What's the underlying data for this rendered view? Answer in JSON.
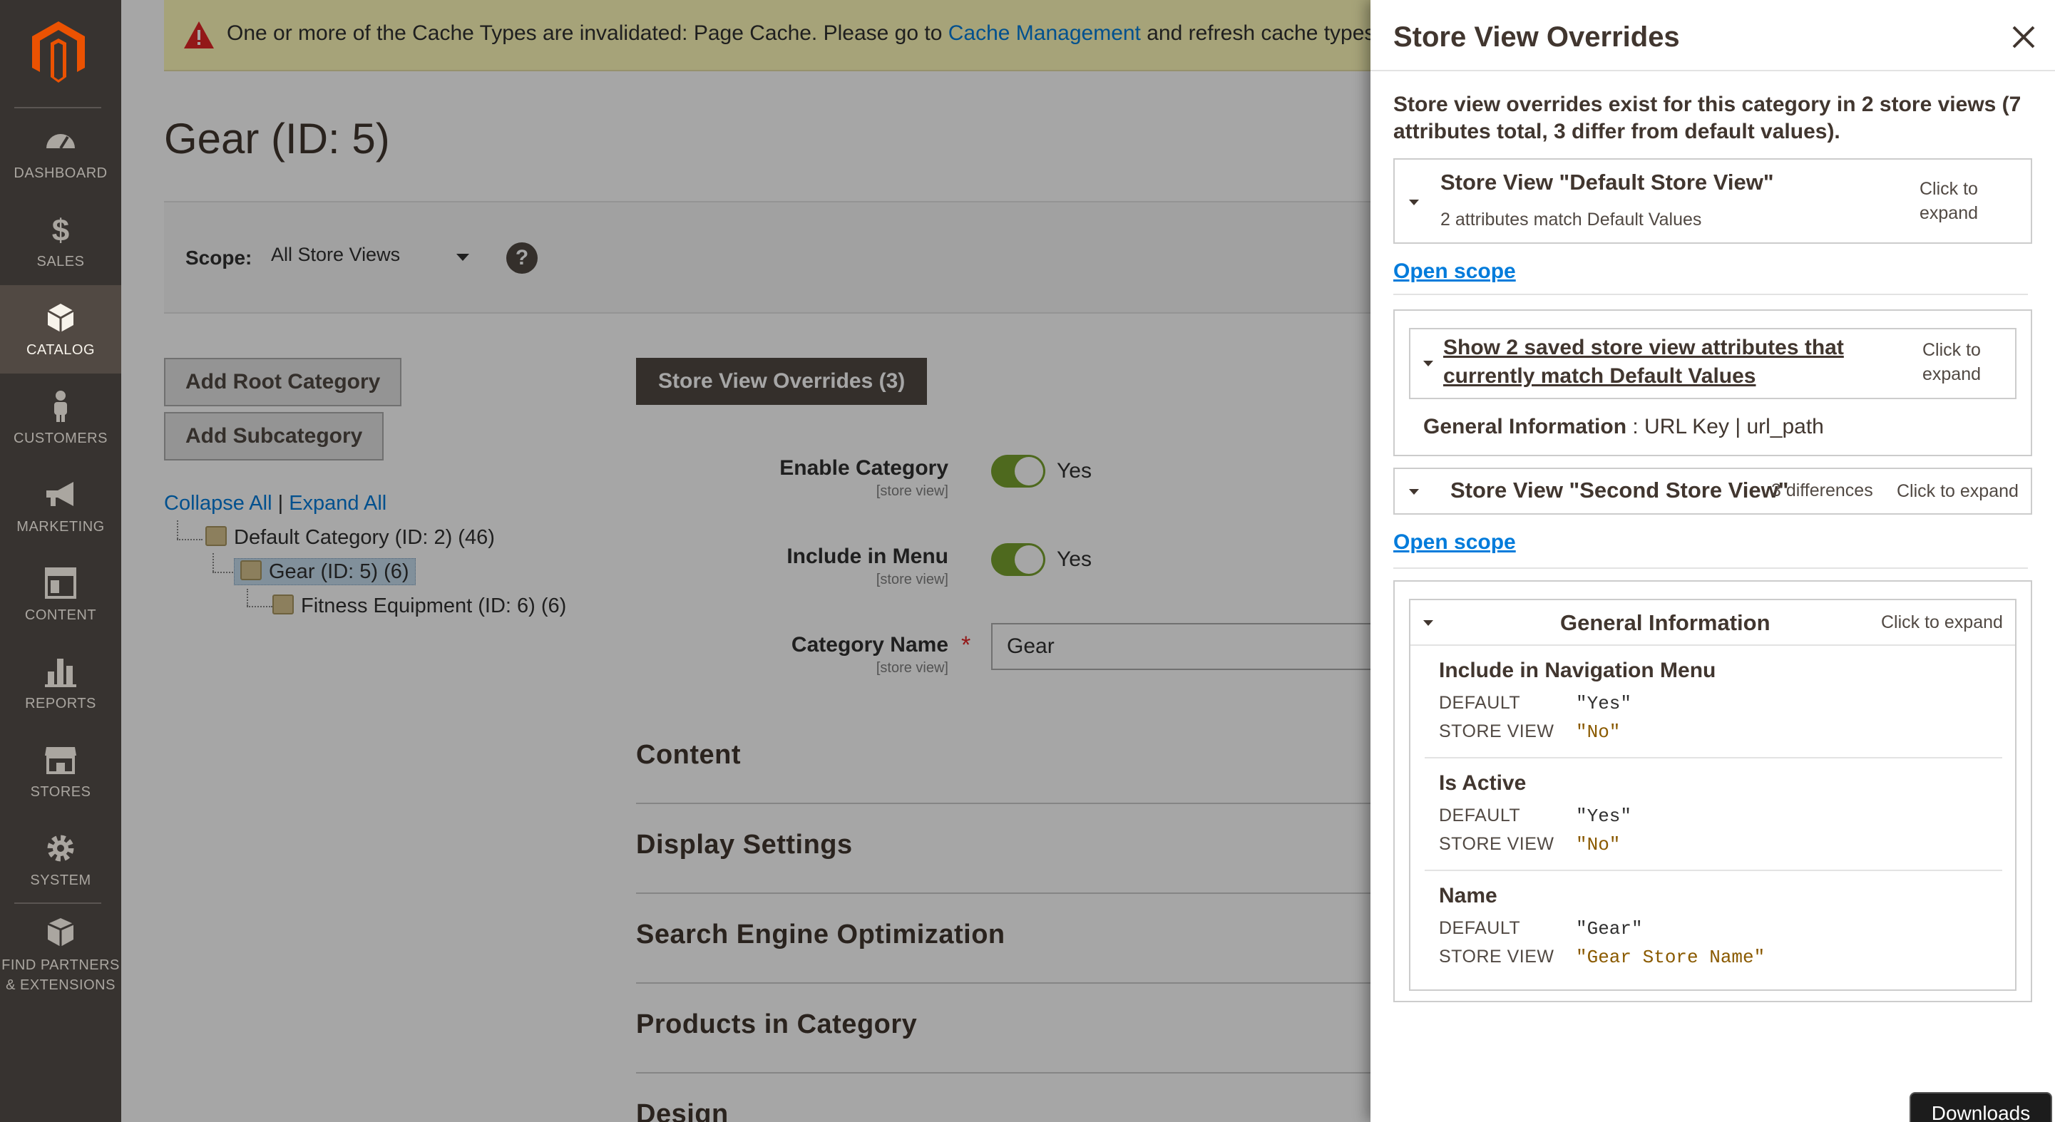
{
  "sidebar": {
    "items": [
      {
        "label": "DASHBOARD",
        "icon": "dashboard-icon"
      },
      {
        "label": "SALES",
        "icon": "dollar-icon"
      },
      {
        "label": "CATALOG",
        "icon": "cube-icon",
        "active": true
      },
      {
        "label": "CUSTOMERS",
        "icon": "person-icon"
      },
      {
        "label": "MARKETING",
        "icon": "megaphone-icon"
      },
      {
        "label": "CONTENT",
        "icon": "layout-icon"
      },
      {
        "label": "REPORTS",
        "icon": "bar-chart-icon"
      },
      {
        "label": "STORES",
        "icon": "storefront-icon"
      },
      {
        "label": "SYSTEM",
        "icon": "gear-icon"
      }
    ],
    "partners": {
      "line1": "FIND PARTNERS",
      "line2": "& EXTENSIONS",
      "icon": "package-icon"
    }
  },
  "notice": {
    "before": "One or more of the Cache Types are invalidated: Page Cache. Please go to ",
    "link": "Cache Management",
    "after": " and refresh cache types."
  },
  "page_title": "Gear (ID: 5)",
  "scope": {
    "label": "Scope:",
    "value": "All Store Views",
    "help": "?"
  },
  "buttons": {
    "add_root": "Add Root Category",
    "add_sub": "Add Subcategory",
    "overrides": "Store View Overrides (3)"
  },
  "tree": {
    "collapse": "Collapse All",
    "separator": "|",
    "expand": "Expand All",
    "nodes": [
      "Default Category (ID: 2) (46)",
      "Gear (ID: 5) (6)",
      "Fitness Equipment (ID: 6) (6)"
    ]
  },
  "fields": {
    "enable": {
      "label": "Enable Category",
      "scope": "[store view]",
      "value": "Yes"
    },
    "menu": {
      "label": "Include in Menu",
      "scope": "[store view]",
      "value": "Yes"
    },
    "name": {
      "label": "Category Name",
      "scope": "[store view]",
      "value": "Gear",
      "required": "*"
    }
  },
  "sections": [
    "Content",
    "Display Settings",
    "Search Engine Optimization",
    "Products in Category",
    "Design"
  ],
  "panel": {
    "title": "Store View Overrides",
    "summary": "Store view overrides exist for this category in 2 store views (7 attributes total, 3 differ from default values).",
    "click_expand": "Click to expand",
    "open_scope": "Open scope",
    "store1": {
      "title": "Store View \"Default Store View\"",
      "sub": "2 attributes match Default Values"
    },
    "saved": {
      "link": "Show 2 saved store view attributes that currently match Default Values",
      "group": "General Information",
      "attrs": " : URL Key | url_path"
    },
    "store2": {
      "title": "Store View \"Second Store View\"",
      "diff": "3 differences"
    },
    "gi": {
      "title": "General Information",
      "default_label": "DEFAULT",
      "store_label": "STORE VIEW",
      "attrs": [
        {
          "name": "Include in Navigation Menu",
          "default": "\"Yes\"",
          "store": "\"No\""
        },
        {
          "name": "Is Active",
          "default": "\"Yes\"",
          "store": "\"No\""
        },
        {
          "name": "Name",
          "default": "\"Gear\"",
          "store": "\"Gear Store Name\""
        }
      ]
    }
  },
  "downloads": "Downloads",
  "colors": {
    "sidebar_bg": "#373330",
    "accent_orange": "#eb5202",
    "link_blue": "#007bdb",
    "toggle_green": "#79a22e"
  }
}
